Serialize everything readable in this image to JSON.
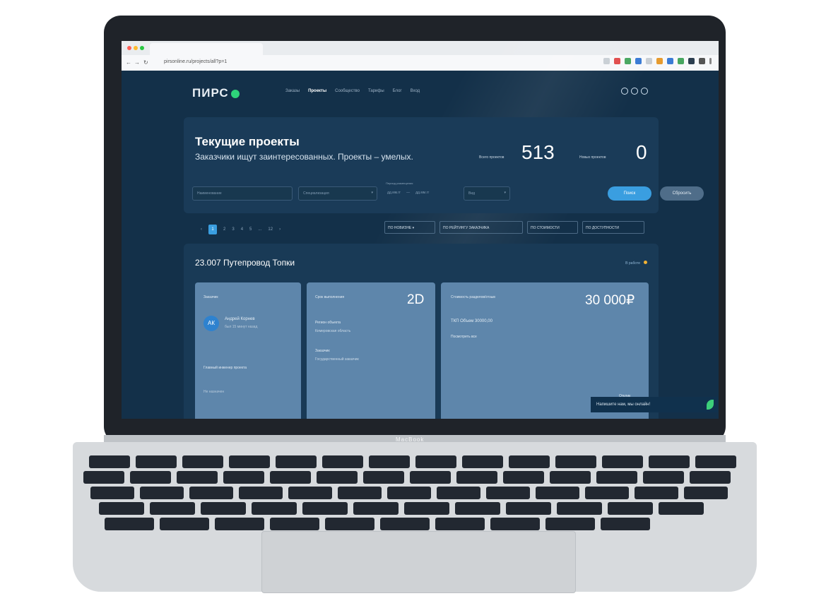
{
  "laptop": {
    "brand": "MacBook"
  },
  "browser": {
    "url": "pirsonline.ru/projects/all?p=1",
    "colors": {
      "close": "#ff5f57",
      "min": "#febc2e",
      "max": "#28c840"
    }
  },
  "header": {
    "logo": "ПИРС",
    "nav": [
      "Заказы",
      "Проекты",
      "Сообщество",
      "Тарифы",
      "Блог",
      "Вход"
    ],
    "active_nav": "Проекты"
  },
  "hero": {
    "title": "Текущие проекты",
    "subtitle": "Заказчики ищут заинтересованных. Проекты – умелых.",
    "total_label": "Всего проектов",
    "total_value": "513",
    "new_label": "Новых проектов",
    "new_value": "0"
  },
  "filters": {
    "name_placeholder": "Наименование",
    "section_placeholder": "Специализация",
    "period_label": "Период размещения",
    "date_from": "дд.мм.гг",
    "date_to": "дд.мм.гг",
    "view_select": "Вид",
    "search_button": "Поиск",
    "reset_button": "Сбросить"
  },
  "pagination": {
    "prev": "‹",
    "pages": [
      "1",
      "2",
      "3",
      "4",
      "5",
      "...",
      "12"
    ],
    "active": "1",
    "next": "›"
  },
  "sort": {
    "by_new": "ПО НОВИЗНЕ",
    "by_rating": "ПО РЕЙТИНГУ ЗАКАЗЧИКА",
    "by_price": "ПО СТОИМОСТИ",
    "by_access": "ПО ДОСТУПНОСТИ"
  },
  "project": {
    "title": "23.007 Путепровод Топки",
    "favorite_label": "В работе",
    "customer_label": "Заказчик",
    "customer_initials": "АК",
    "customer_name": "Андрей Корнев",
    "customer_status": "был 15 минут назад",
    "manager_label": "Главный инженер проекта",
    "manager_value": "Не назначен",
    "duration_label": "Срок выполнения",
    "duration_value": "2D",
    "region_label": "Регион объекта",
    "region_value": "Кемеровская область",
    "client_label": "Заказчик",
    "client_value": "Государственный заказчик",
    "cost_label": "Стоимость разделов/отзыв",
    "cost_value": "30 000₽",
    "cost_line": "ТКП Объем  30000,00",
    "cost_more": "Посмотреть все",
    "reply_label": "Отклик"
  },
  "chat": {
    "text": "Напишите нам, мы онлайн!",
    "accent": "#3ccf7a"
  }
}
